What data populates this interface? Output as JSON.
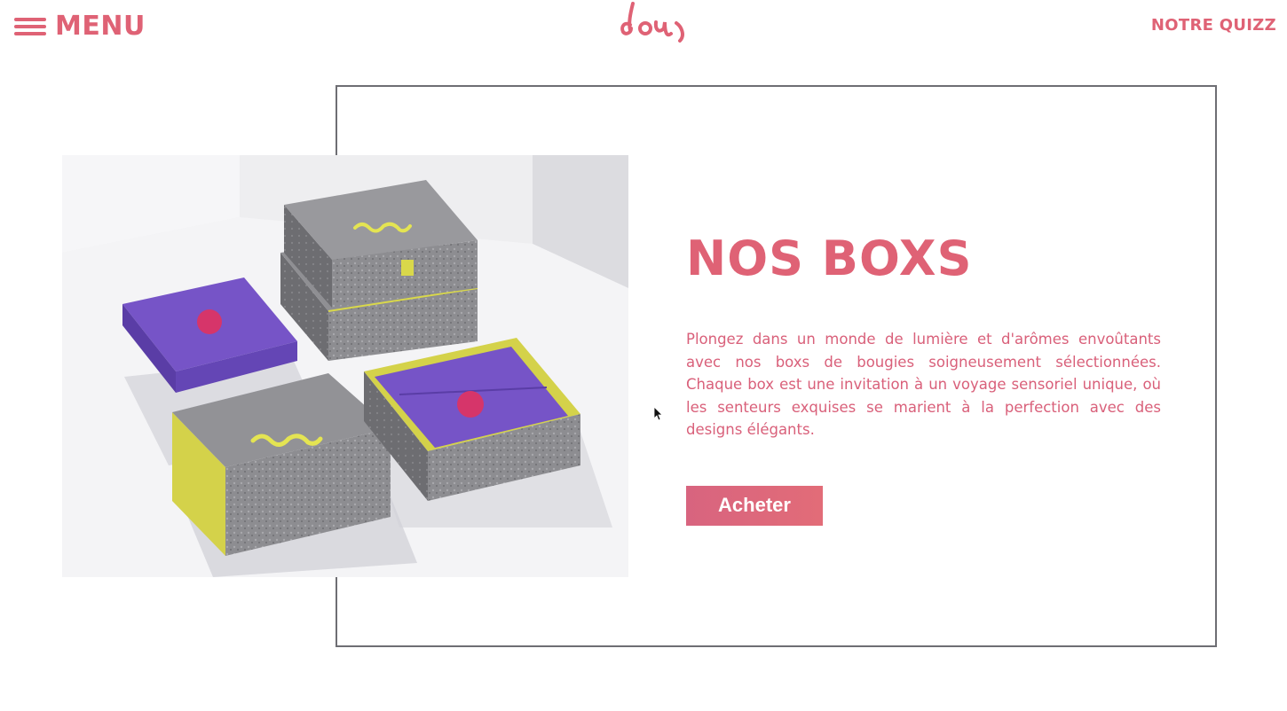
{
  "header": {
    "menu_label": "MENU",
    "quiz_label": "NOTRE QUIZZ"
  },
  "hero": {
    "title": "NOS BOXS",
    "description": "Plongez dans un monde de lumière et d'arômes envoûtants avec nos boxs de bougies soigneusement sélectionnées. Chaque box est une invitation à un voyage sensoriel unique, où les senteurs exquises se marient à la perfection avec des designs élégants.",
    "cta_label": "Acheter"
  },
  "colors": {
    "brand_pink": "#df6275",
    "frame_border": "#6e6e73",
    "box_purple": "#7654c7",
    "box_yellow": "#d9d84a",
    "box_gray": "#8d8d91"
  },
  "icons": {
    "menu": "hamburger-icon",
    "logo": "joy-logo",
    "cursor": "mouse-pointer"
  }
}
